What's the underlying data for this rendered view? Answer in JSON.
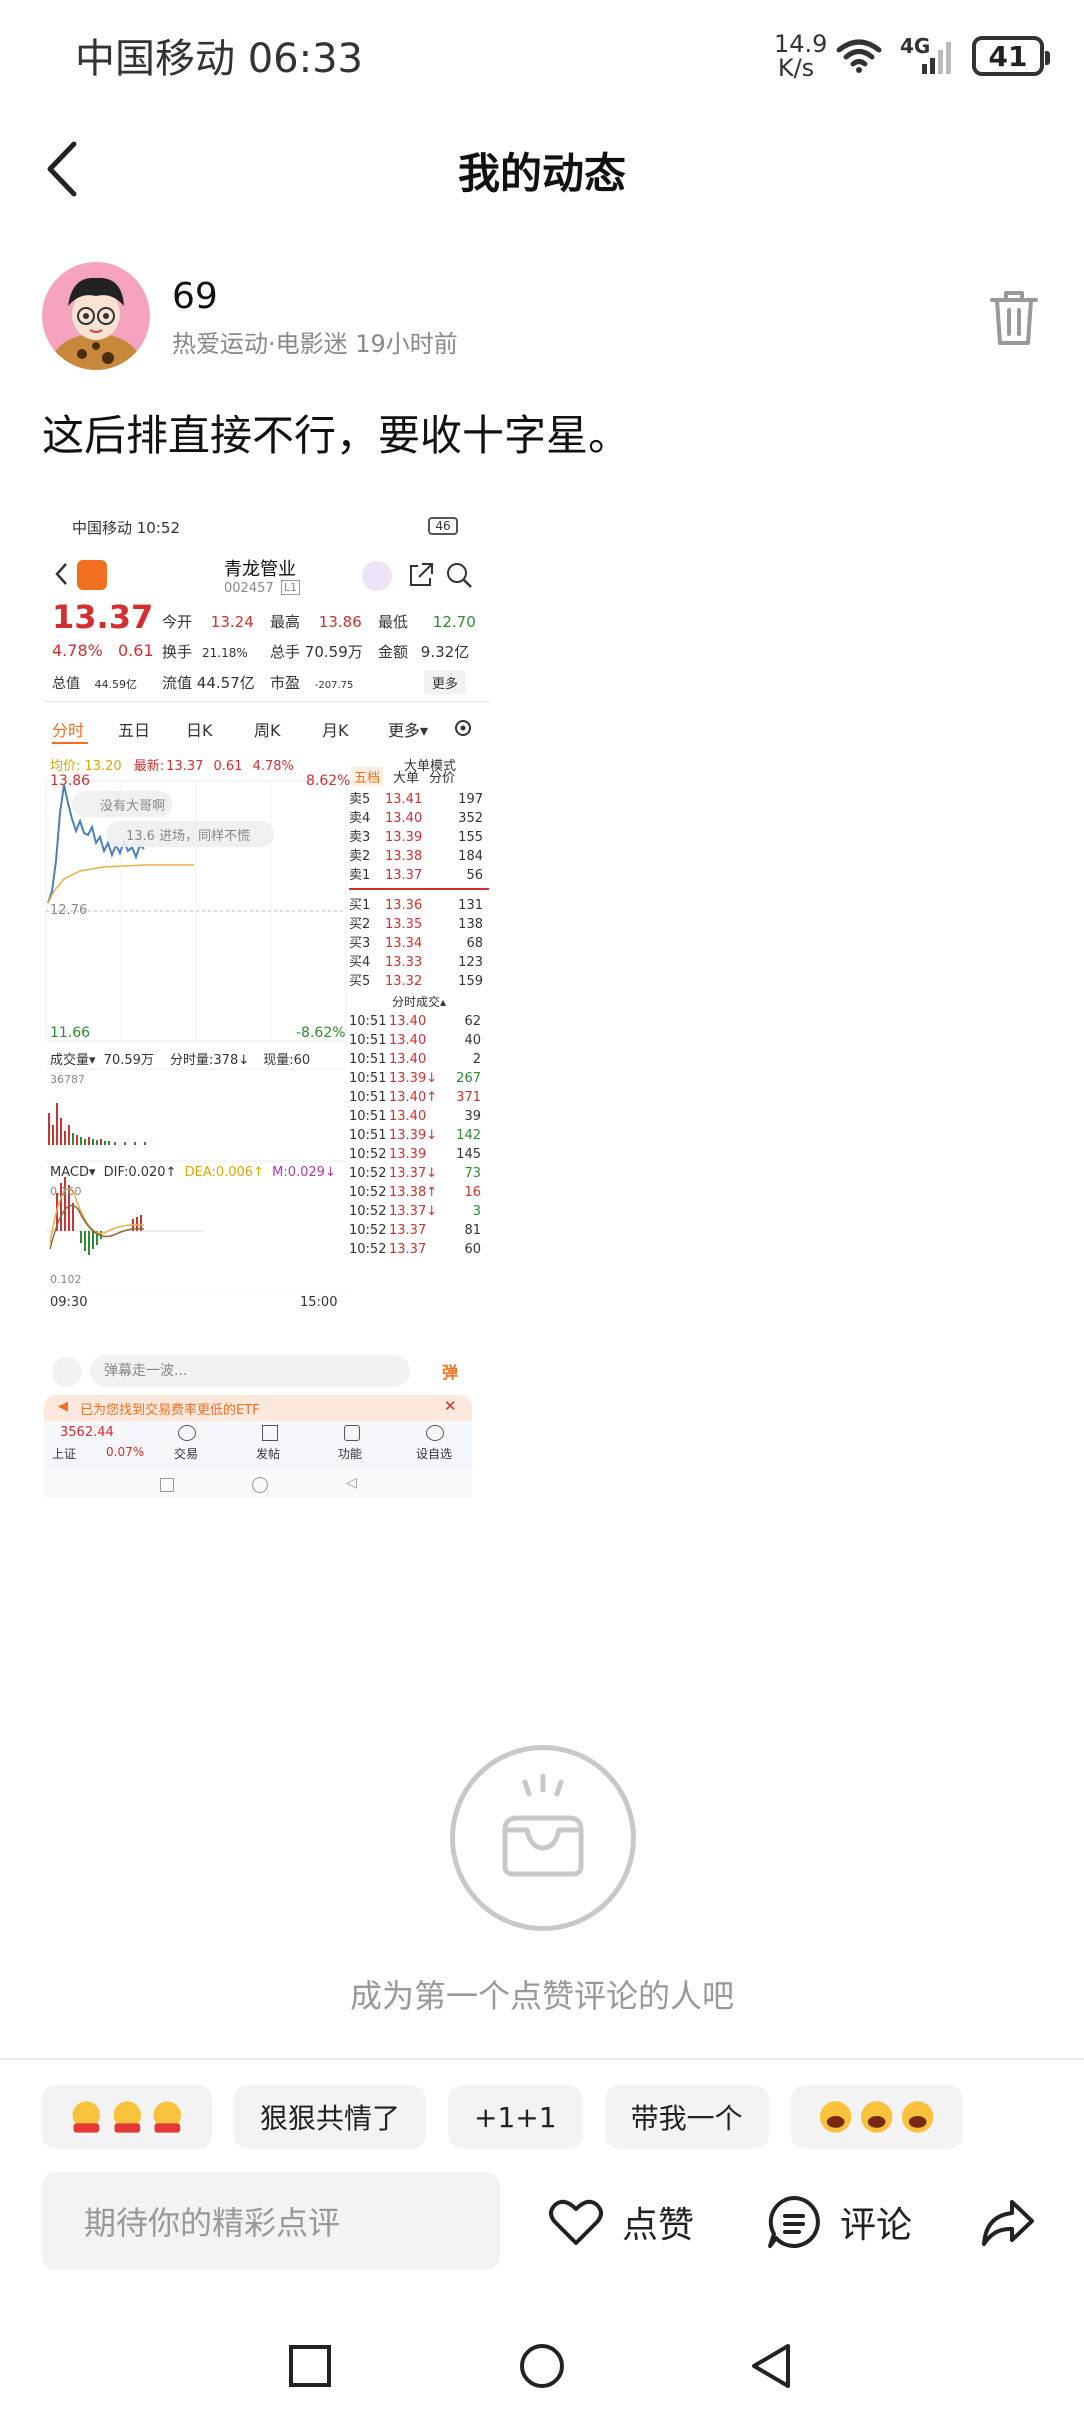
{
  "status_bar": {
    "carrier_time": "中国移动 06:33",
    "net_speed_value": "14.9",
    "net_speed_unit": "K/s",
    "network": "4G",
    "battery": "41"
  },
  "nav": {
    "title": "我的动态"
  },
  "author": {
    "name": "69",
    "meta": "热爱运动·电影迷 19小时前"
  },
  "post": {
    "text": "这后排直接不行，要收十字星。"
  },
  "screenshot": {
    "status": "中国移动 10:52",
    "status_right": "46",
    "stock_name": "青龙管业",
    "stock_code": "002457",
    "stock_level": "L1",
    "price": "13.37",
    "change_pct": "4.78%",
    "change": "0.61",
    "labels": {
      "open": "今开",
      "high": "最高",
      "low": "最低",
      "turnover": "换手",
      "volume_total": "总手",
      "amount": "金额",
      "total_mv": "总值",
      "float_mv": "流值",
      "pe": "市盈",
      "more": "更多"
    },
    "values": {
      "open": "13.24",
      "high": "13.86",
      "low": "12.70",
      "turnover": "21.18%",
      "volume_total": "70.59万",
      "amount": "9.32亿",
      "total_mv": "44.59亿",
      "float_mv": "44.57亿",
      "pe": "-207.75"
    },
    "tabs": [
      "分时",
      "五日",
      "日K",
      "周K",
      "月K",
      "更多▾"
    ],
    "avg_label": "均价:",
    "avg_value": "13.20",
    "latest_label": "最新:",
    "latest_value": "13.37",
    "latest_change": "0.61",
    "latest_pct": "4.78%",
    "big_order_mode": "大单模式",
    "chart_top": "13.86",
    "chart_top_pct": "8.62%",
    "chart_bottom": "11.66",
    "chart_bottom_pct": "-8.62%",
    "chart_mid": "12.76",
    "bubble1": "没有大哥啊",
    "bubble2": "13.6 进场，同样不慌",
    "volume_label": "成交量▾",
    "volume_value": "70.59万",
    "tick_volume": "分时量:378↓",
    "now_volume": "现量:60",
    "volume_max": "36787",
    "macd_label": "MACD▾",
    "dif": "DIF:0.020↑",
    "dea": "DEA:0.006↑",
    "m": "M:0.029↓",
    "macd_top": "0.160",
    "macd_bottom": "0.102",
    "time_start": "09:30",
    "time_end": "15:00",
    "order_tabs": [
      "五档",
      "大单",
      "分价"
    ],
    "asks": [
      {
        "label": "卖5",
        "price": "13.41",
        "vol": "197"
      },
      {
        "label": "卖4",
        "price": "13.40",
        "vol": "352"
      },
      {
        "label": "卖3",
        "price": "13.39",
        "vol": "155"
      },
      {
        "label": "卖2",
        "price": "13.38",
        "vol": "184"
      },
      {
        "label": "卖1",
        "price": "13.37",
        "vol": "56"
      }
    ],
    "bids": [
      {
        "label": "买1",
        "price": "13.36",
        "vol": "131"
      },
      {
        "label": "买2",
        "price": "13.35",
        "vol": "138"
      },
      {
        "label": "买3",
        "price": "13.34",
        "vol": "68"
      },
      {
        "label": "买4",
        "price": "13.33",
        "vol": "123"
      },
      {
        "label": "买5",
        "price": "13.32",
        "vol": "159"
      }
    ],
    "trades_title": "分时成交▴",
    "trades": [
      {
        "time": "10:51",
        "price": "13.40",
        "vol": "62",
        "dir": ""
      },
      {
        "time": "10:51",
        "price": "13.40",
        "vol": "40",
        "dir": ""
      },
      {
        "time": "10:51",
        "price": "13.40",
        "vol": "2",
        "dir": ""
      },
      {
        "time": "10:51",
        "price": "13.39↓",
        "vol": "267",
        "dir": "down"
      },
      {
        "time": "10:51",
        "price": "13.40↑",
        "vol": "371",
        "dir": "up"
      },
      {
        "time": "10:51",
        "price": "13.40",
        "vol": "39",
        "dir": ""
      },
      {
        "time": "10:51",
        "price": "13.39↓",
        "vol": "142",
        "dir": "down"
      },
      {
        "time": "10:52",
        "price": "13.39",
        "vol": "145",
        "dir": ""
      },
      {
        "time": "10:52",
        "price": "13.37↓",
        "vol": "73",
        "dir": "down"
      },
      {
        "time": "10:52",
        "price": "13.38↑",
        "vol": "16",
        "dir": "up"
      },
      {
        "time": "10:52",
        "price": "13.37↓",
        "vol": "3",
        "dir": "down"
      },
      {
        "time": "10:52",
        "price": "13.37",
        "vol": "81",
        "dir": ""
      },
      {
        "time": "10:52",
        "price": "13.37",
        "vol": "60",
        "dir": ""
      }
    ],
    "danmu_placeholder": "弹幕走一波...",
    "danmu_btn": "弹",
    "etf_banner": "已为您找到交易费率更低的ETF",
    "bottom_nav": [
      {
        "label": "上证",
        "value": "3562.44",
        "pct": "0.07%"
      },
      {
        "label": "交易"
      },
      {
        "label": "发帖"
      },
      {
        "label": "功能"
      },
      {
        "label": "设自选"
      }
    ]
  },
  "empty_state": {
    "text": "成为第一个点赞评论的人吧"
  },
  "quick_replies": [
    "狠狠共情了",
    "+1+1",
    "带我一个"
  ],
  "comment_bar": {
    "placeholder": "期待你的精彩点评",
    "like": "点赞",
    "comment": "评论"
  },
  "colors": {
    "red": "#d32f2f",
    "green": "#2e8b2e",
    "orange": "#f07020"
  }
}
